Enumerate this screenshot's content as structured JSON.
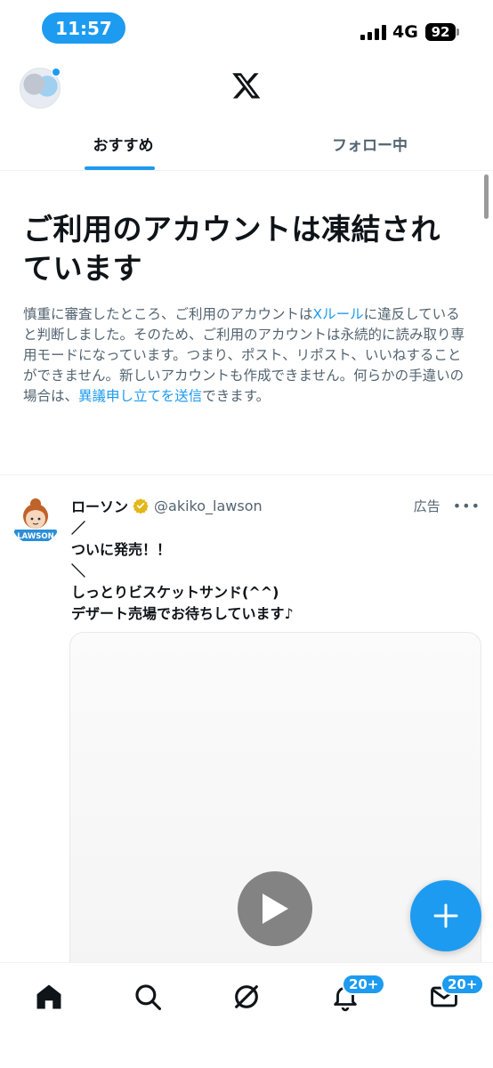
{
  "status_bar": {
    "time": "11:57",
    "network": "4G",
    "battery": "92"
  },
  "header": {
    "logo_icon": "x-logo-icon",
    "has_notification_dot": true
  },
  "tabs": [
    {
      "label": "おすすめ",
      "active": true
    },
    {
      "label": "フォロー中",
      "active": false
    }
  ],
  "notice": {
    "title_line1": "ご利用のアカウントは凍結され",
    "title_line2": "ています",
    "body_part1": "慎重に審査したところ、ご利用のアカウントは",
    "link_rules": "Xルール",
    "body_part2": "に違反していると判断しました。そのため、ご利用のアカウントは永続的に読み取り専用モードになっています。つまり、ポスト、リポスト、いいねすることができません。新しいアカウントも作成できません。何らかの手違いの場合は、",
    "link_appeal": "異議申し立てを送信",
    "body_part3": "できます。"
  },
  "post": {
    "avatar_label": "LAWSON",
    "name": "ローソン",
    "verified": true,
    "handle": "@akiko_lawson",
    "ad_label": "広告",
    "more_label": "•••",
    "lines": [
      "／",
      "ついに発売！！",
      "＼",
      "しっとりビスケットサンド(^^)",
      "デザート売場でお待ちしています♪"
    ]
  },
  "bottom_nav": {
    "notifications_badge": "20+",
    "messages_badge": "20+"
  },
  "colors": {
    "accent": "#1d9bf0",
    "text": "#0f1419",
    "muted": "#536471",
    "verified_gold": "#e2b719"
  }
}
